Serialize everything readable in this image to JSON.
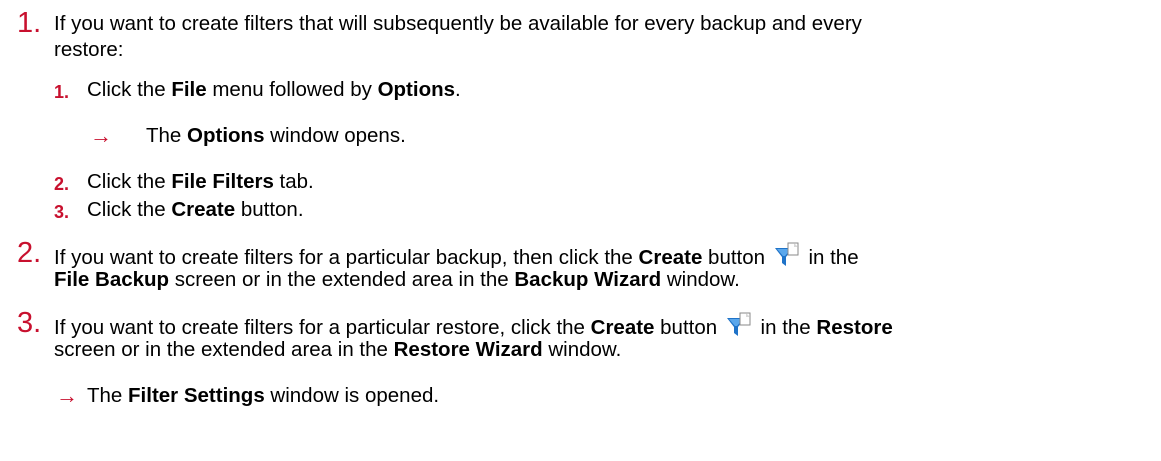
{
  "steps": [
    {
      "number": "1.",
      "intro": "If you want to create filters that will subsequently be available for every backup and every",
      "intro_cont": "restore:",
      "substeps": [
        {
          "number": "1.",
          "pre": "Click the ",
          "b1": "File",
          "mid": " menu followed by ",
          "b2": "Options",
          "post": "."
        },
        {
          "number": "2.",
          "pre": "Click the ",
          "b1": "File Filters",
          "post": " tab."
        },
        {
          "number": "3.",
          "pre": "Click the ",
          "b1": "Create",
          "post": " button."
        }
      ],
      "result": {
        "pre": "The ",
        "b": "Options",
        "post": " window opens."
      }
    },
    {
      "number": "2.",
      "l1_pre": "If you want to create filters for a particular backup, then click the ",
      "l1_b": "Create",
      "l1_mid": " button",
      "l1_post": " in the",
      "l2_b1": "File Backup",
      "l2_mid": " screen or in the extended area in the ",
      "l2_b2": "Backup Wizard",
      "l2_post": " window."
    },
    {
      "number": "3.",
      "l1_pre": "If you want to create filters for a particular restore, click the ",
      "l1_b": "Create",
      "l1_mid": " button",
      "l1_between": " in the ",
      "l1_b2": "Restore",
      "l2_pre": "screen or in the extended area in the ",
      "l2_b": "Restore Wizard",
      "l2_post": " window."
    }
  ],
  "final_result": {
    "pre": "The ",
    "b": "Filter Settings",
    "post": " window is opened."
  },
  "colors": {
    "accent": "#c8102e",
    "icon_blue": "#1f73c8"
  },
  "icons": {
    "arrow": "→",
    "filter_icon": "filter-create-icon"
  }
}
